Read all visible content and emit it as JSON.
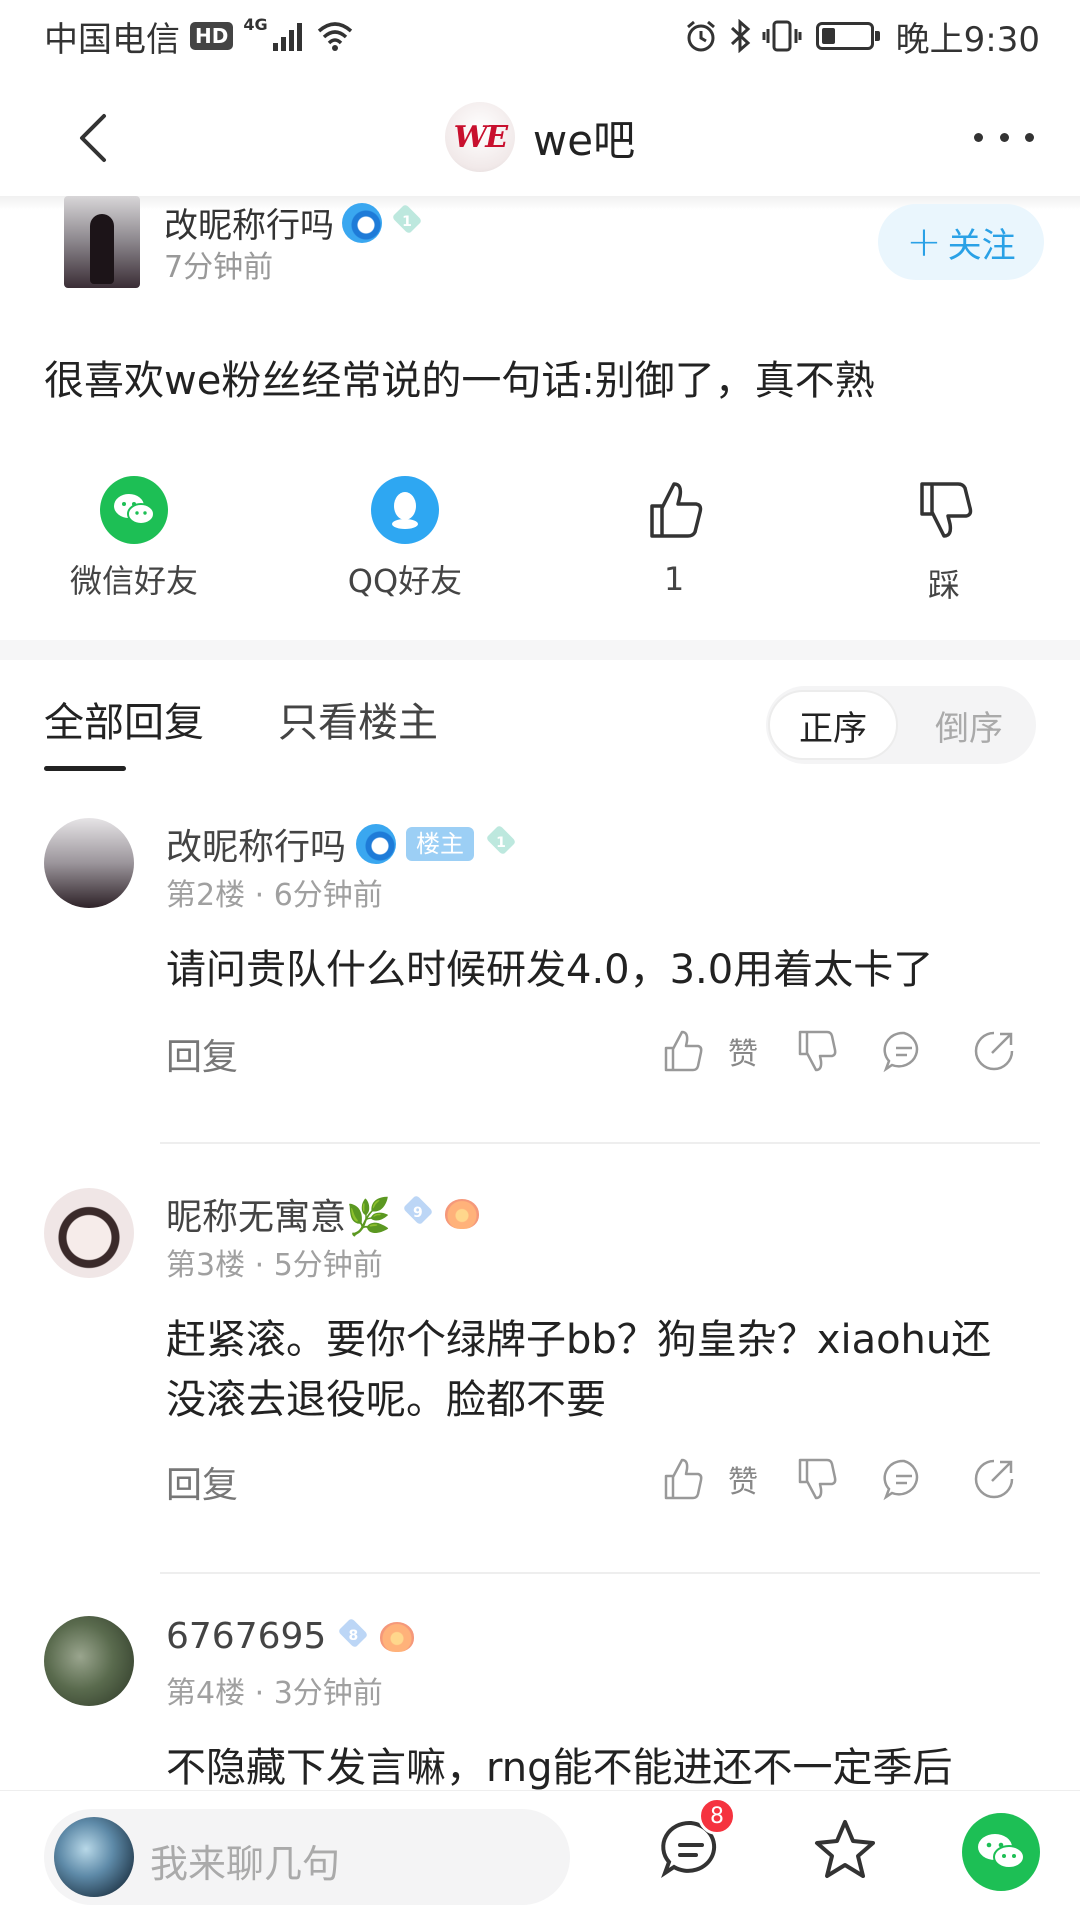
{
  "status_bar": {
    "carrier": "中国电信",
    "hd": "HD",
    "network": "4G",
    "time": "晚上9:30"
  },
  "nav": {
    "forum_name": "we吧",
    "logo_text": "WE"
  },
  "post": {
    "author": "改昵称行吗",
    "author_level": "1",
    "time": "7分钟前",
    "follow_label": "关注",
    "content": "很喜欢we粉丝经常说的一句话:别御了，真不熟"
  },
  "share": {
    "wechat_label": "微信好友",
    "qq_label": "QQ好友",
    "like_count": "1",
    "dislike_label": "踩"
  },
  "tabs": {
    "all": "全部回复",
    "owner_only": "只看楼主",
    "sort_asc": "正序",
    "sort_desc": "倒序"
  },
  "comments": [
    {
      "name": "改昵称行吗",
      "owner_tag": "楼主",
      "level": "1",
      "floor": "第2楼",
      "time": "6分钟前",
      "text": "请问贵队什么时候研发4.0，3.0用着太卡了",
      "reply_label": "回复",
      "like_label": "赞"
    },
    {
      "name": "昵称无寓意🌿",
      "level": "9",
      "floor": "第3楼",
      "time": "5分钟前",
      "text": "赶紧滚。要你个绿牌子bb？狗皇杂？xiaohu还没滚去退役呢。脸都不要",
      "reply_label": "回复",
      "like_label": "赞"
    },
    {
      "name": "6767695",
      "level": "8",
      "floor": "第4楼",
      "time": "3分钟前",
      "text": "不隐藏下发言嘛，rng能不能进还不一定季后"
    }
  ],
  "bottom_bar": {
    "placeholder": "我来聊几句",
    "message_badge": "8"
  },
  "colors": {
    "accent_blue": "#2aa1e6",
    "wechat_green": "#1dbf55",
    "qq_blue": "#2ea7f2",
    "badge_red": "#f5333f"
  }
}
